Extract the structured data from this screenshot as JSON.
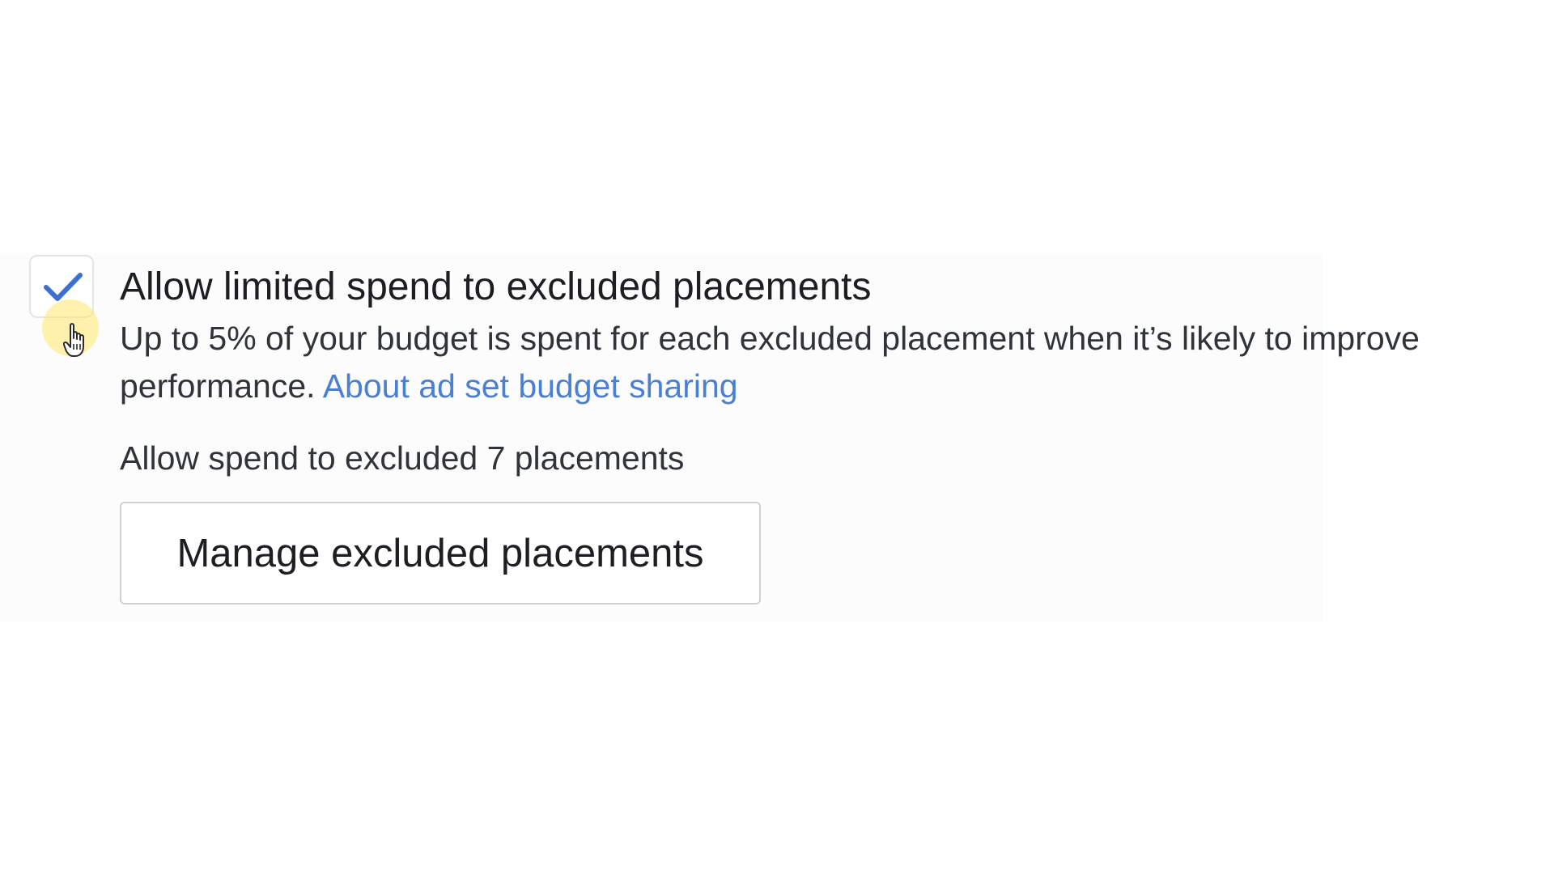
{
  "setting": {
    "checkbox": {
      "checked": true,
      "check_color": "#3b6fd0"
    },
    "title": "Allow limited spend to excluded placements",
    "description": "Up to 5% of your budget is spent for each excluded placement when it’s likely to improve performance.",
    "link_text": "About ad set budget sharing",
    "link_color": "#4a7fd4",
    "status_text": "Allow spend to excluded 7 placements",
    "button_label": "Manage excluded placements"
  },
  "cursor": {
    "icon": "hand-pointer-icon",
    "highlight_color": "#ffe86e"
  }
}
